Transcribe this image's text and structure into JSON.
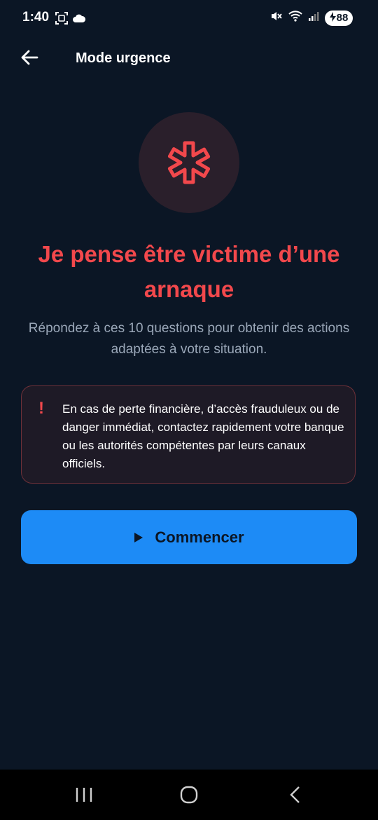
{
  "status_bar": {
    "time": "1:40",
    "battery_level": "88"
  },
  "app_bar": {
    "title": "Mode urgence"
  },
  "hero": {
    "icon": "medical-asterisk-icon",
    "headline": "Je pense être victime d’une arnaque",
    "subtitle": "Répondez à ces 10 questions pour obtenir des actions adaptées à votre situation."
  },
  "warning": {
    "icon_glyph": "!",
    "text": "En cas de perte financière, d’accès frauduleux ou de danger immédiat, contactez rapidement votre banque ou les autorités compétentes par leurs canaux officiels."
  },
  "start_button": {
    "label": "Commencer"
  },
  "colors": {
    "background": "#0b1625",
    "accent_red": "#f2484c",
    "primary_blue": "#1d8bf6"
  }
}
